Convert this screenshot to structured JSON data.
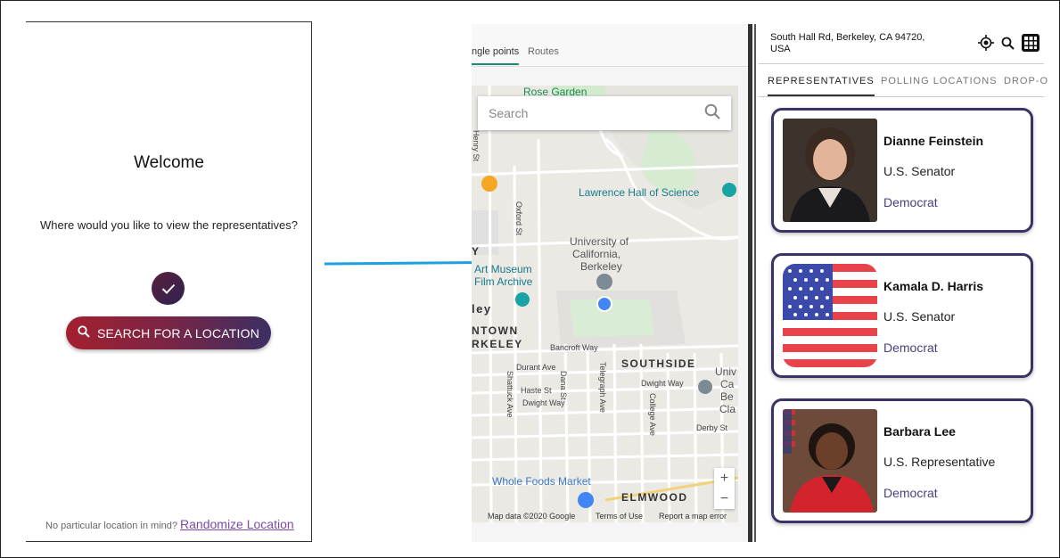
{
  "welcome_screen": {
    "title": "Welcome",
    "question": "Where would you like to view the representatives?",
    "search_button_label": "SEARCH FOR A  LOCATION",
    "no_location_text": "No particular location in mind?",
    "randomize_link": "Randomize Location"
  },
  "map_screen": {
    "tabs": [
      "ngle points",
      "Routes"
    ],
    "search_placeholder": "Search",
    "labels": {
      "rose_garden": "Rose Garden",
      "lawrence": "Lawrence Hall of Science",
      "university_1": "University of",
      "university_2": "California,",
      "university_3": "Berkeley",
      "art_museum_1": "Art Museum",
      "art_museum_2": "Film Archive",
      "ley": "ley",
      "downtown_1": "NTOWN",
      "downtown_2": "RKELEY",
      "southside": "SOUTHSIDE",
      "bancroft": "Bancroft Way",
      "durant": "Durant Ave",
      "haste": "Haste St",
      "dwight": "Dwight Way",
      "dwight2": "Dwight Way",
      "dana": "Dana St",
      "telegraph": "Telegraph Ave",
      "college": "College Ave",
      "shattuck": "Shattuck Ave",
      "oxford": "Oxford St",
      "henry": "Henry St",
      "derby": "Derby St",
      "univ_right": "Univ",
      "cal_right_1": "Ca",
      "cal_right_2": "Be",
      "cal_right_3": "Cla",
      "whole_foods": "Whole Foods Market",
      "elmwood": "ELMWOOD",
      "y_letter": "Y"
    },
    "footer": {
      "data": "Map data ©2020 Google",
      "terms": "Terms of Use",
      "report": "Report a map error"
    },
    "zoom_in": "+",
    "zoom_out": "−"
  },
  "results_screen": {
    "address": "South Hall Rd, Berkeley, CA 94720, USA",
    "tabs": [
      "REPRESENTATIVES",
      "POLLING LOCATIONS",
      "DROP-O"
    ],
    "representatives": [
      {
        "name": "Dianne Feinstein",
        "office": "U.S. Senator",
        "party": "Democrat"
      },
      {
        "name": "Kamala D. Harris",
        "office": "U.S. Senator",
        "party": "Democrat"
      },
      {
        "name": "Barbara Lee",
        "office": "U.S. Representative",
        "party": "Democrat"
      }
    ]
  },
  "colors": {
    "brand_purple": "#3b3366",
    "button_red": "#a3202f",
    "arrow_blue": "#1ea0e0",
    "map_teal": "#1a8a7a"
  }
}
